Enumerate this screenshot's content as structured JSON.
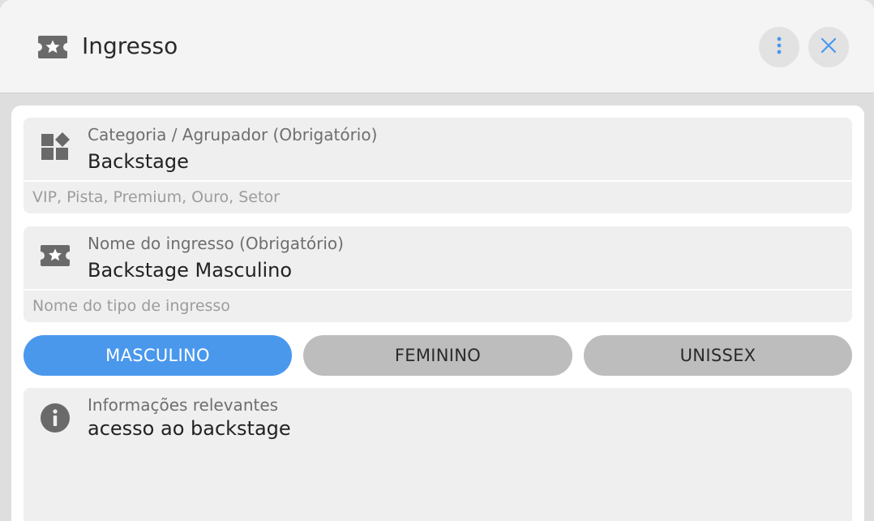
{
  "header": {
    "title": "Ingresso",
    "icon": "ticket-star-icon",
    "more_icon": "more-vertical-icon",
    "close_icon": "close-icon"
  },
  "category_field": {
    "icon": "category-icon",
    "label": "Categoria / Agrupador (Obrigatório)",
    "value": "Backstage",
    "hint": "VIP, Pista, Premium, Ouro, Setor"
  },
  "name_field": {
    "icon": "ticket-star-icon",
    "label": "Nome do ingresso (Obrigatório)",
    "value": "Backstage Masculino",
    "hint": "Nome do tipo de ingresso"
  },
  "gender_options": [
    {
      "label": "MASCULINO",
      "selected": true
    },
    {
      "label": "FEMININO",
      "selected": false
    },
    {
      "label": "UNISSEX",
      "selected": false
    }
  ],
  "info_field": {
    "icon": "info-icon",
    "label": "Informações relevantes",
    "value": "acesso ao backstage"
  },
  "colors": {
    "accent": "#4a98ec",
    "icon_gray": "#6a6a6a",
    "segment_inactive": "#bdbdbd"
  }
}
